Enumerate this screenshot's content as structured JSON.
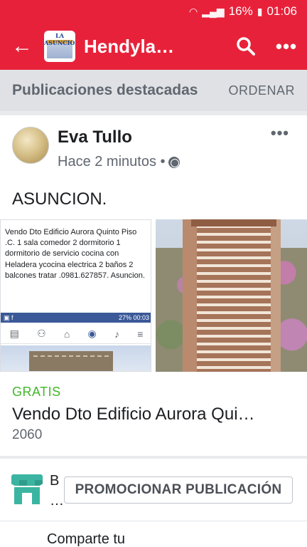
{
  "status": {
    "battery": "16%",
    "time": "01:06"
  },
  "appbar": {
    "title": "Hendyla…"
  },
  "section": {
    "title": "Publicaciones destacadas",
    "order_label": "ORDENAR"
  },
  "post": {
    "author": "Eva Tullo",
    "time": "Hace 2 minutos •",
    "text": "ASUNCION.",
    "image_text": "Vendo Dto Edificio Aurora Quinto Piso .C. 1 sala comedor 2 dormitorio 1 dormitorio de servicio  cocina con Heladera ycocina electrica 2 baños  2 balcones  tratar .0981.627857. Asuncion.",
    "mini_status": "27% 00:03",
    "badge": "GRATIS",
    "title": "Vendo Dto Edificio Aurora Qui…",
    "price": "2060"
  },
  "promo": {
    "business_initial": "B",
    "business_dots": "…",
    "button_label": "PROMOCIONAR PUBLICACIÓN"
  },
  "share": {
    "text": "Comparte tu"
  }
}
